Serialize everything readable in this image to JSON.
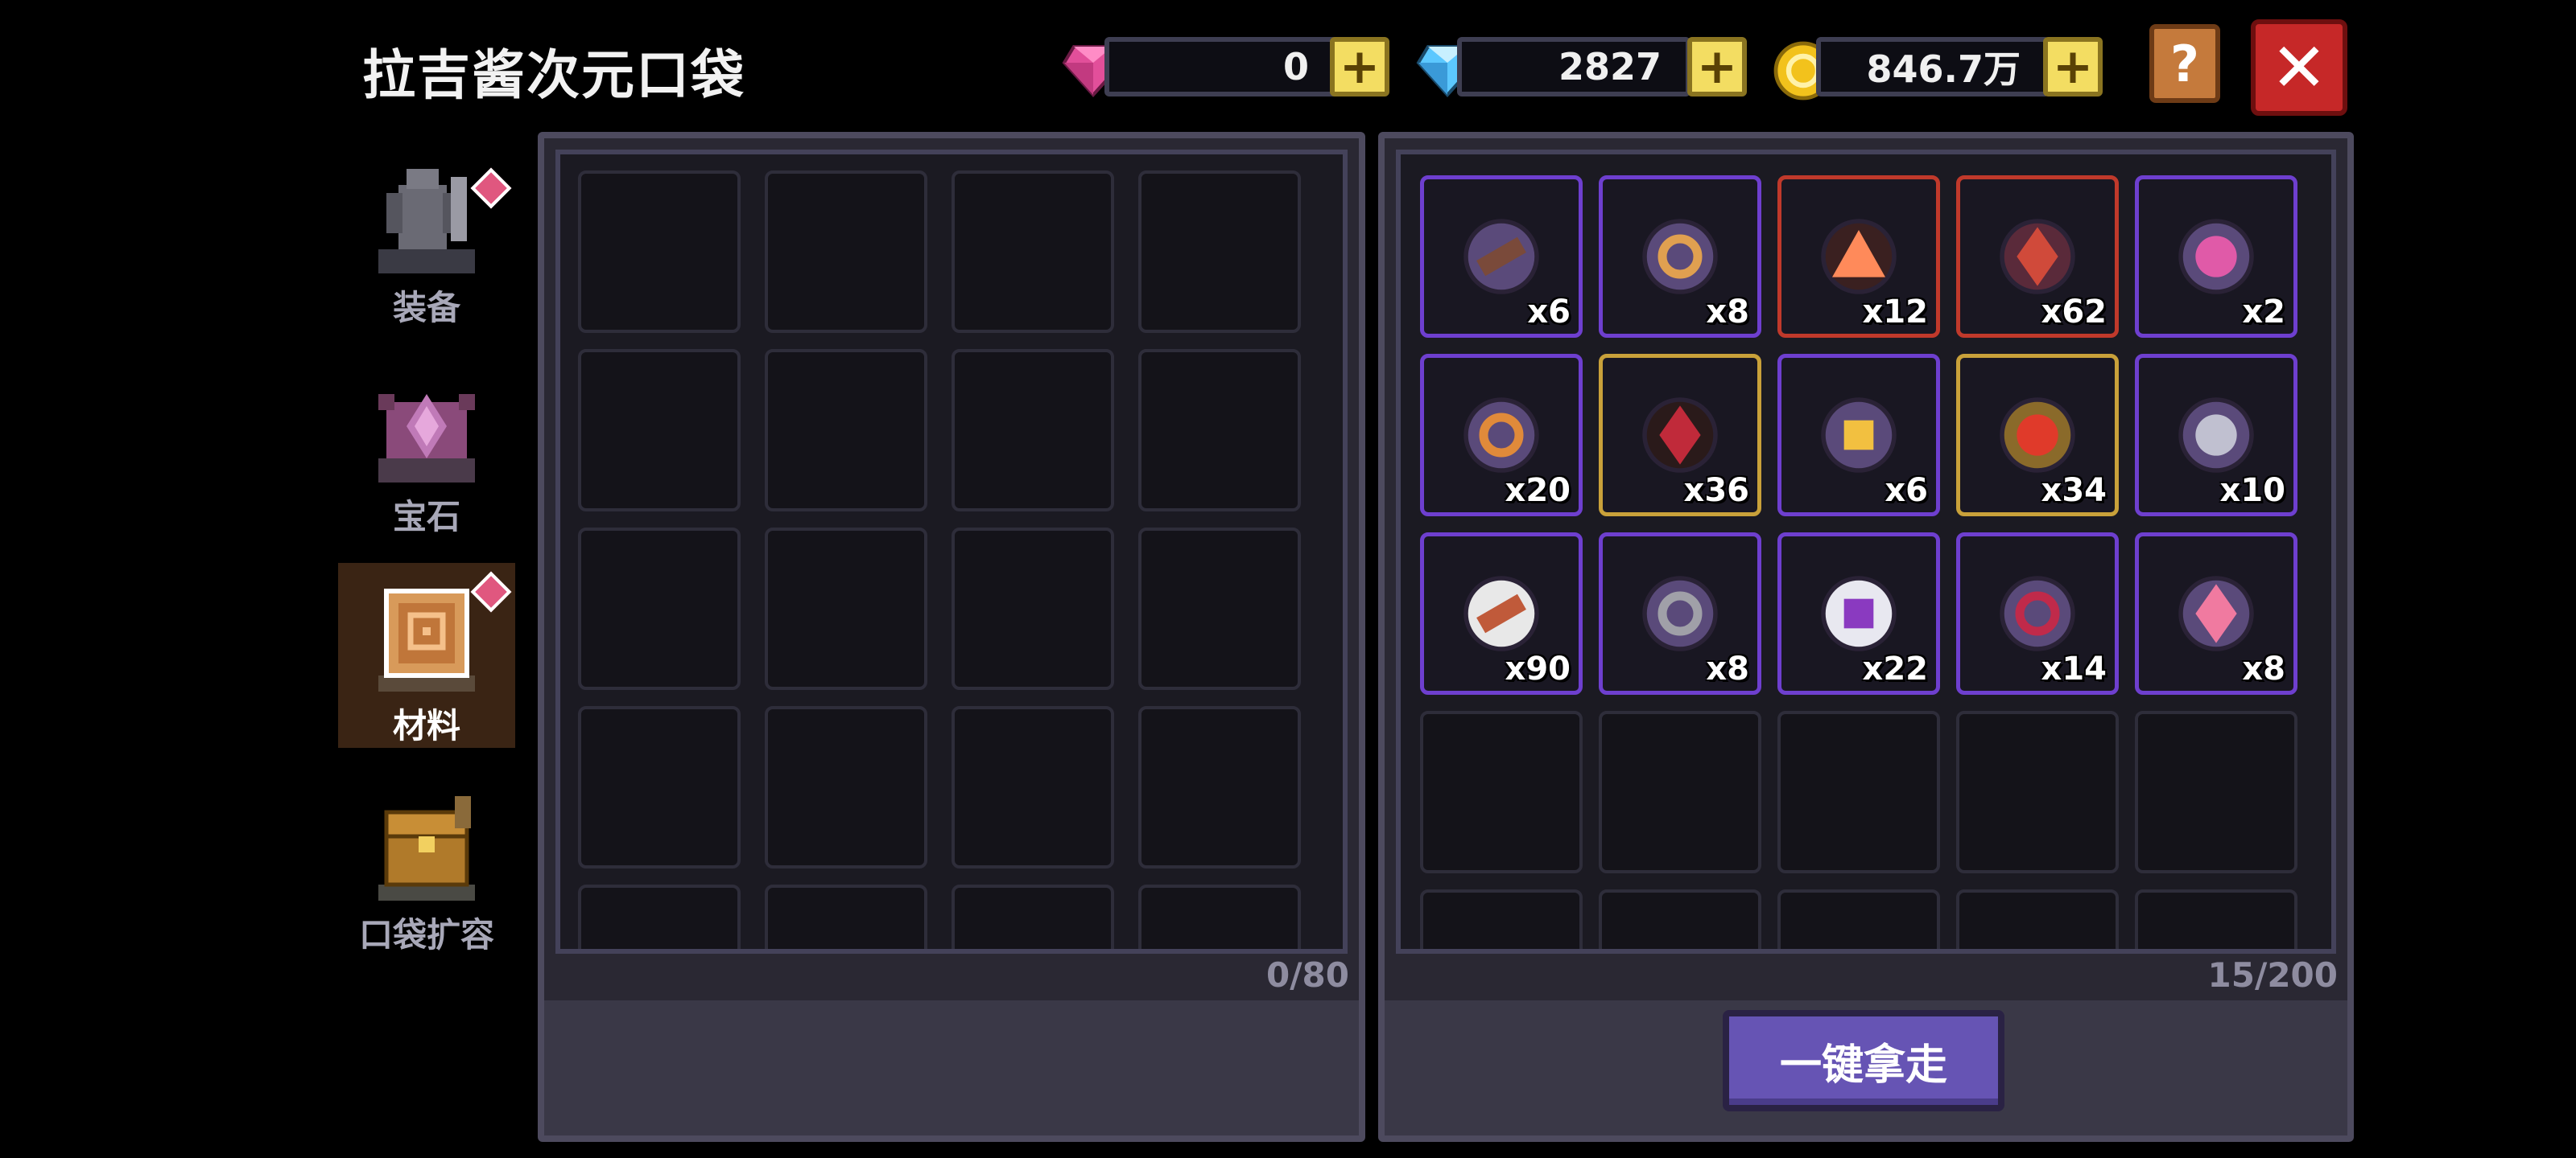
{
  "header": {
    "title": "拉吉酱次元口袋",
    "currencies": [
      {
        "name": "pink-gem",
        "icon": "pink-gem-icon",
        "value": "0",
        "color": "#e24f9a"
      },
      {
        "name": "blue-gem",
        "icon": "blue-diamond-icon",
        "value": "2827",
        "color": "#5cc8ff"
      },
      {
        "name": "gold-coin",
        "icon": "gold-coin-icon",
        "value": "846.7万",
        "color": "#f2c21c"
      }
    ],
    "help_label": "?",
    "close_label": "✕"
  },
  "sidebar": {
    "items": [
      {
        "label": "装备",
        "icon": "armor-icon",
        "badge": true,
        "active": false
      },
      {
        "label": "宝石",
        "icon": "gem-altar-icon",
        "badge": false,
        "active": false
      },
      {
        "label": "材料",
        "icon": "material-book-icon",
        "badge": true,
        "active": true
      },
      {
        "label": "口袋扩容",
        "icon": "treasure-chest-icon",
        "badge": false,
        "active": false
      }
    ]
  },
  "left_panel": {
    "capacity": "0/80"
  },
  "right_panel": {
    "capacity": "15/200",
    "take_all_label": "一键拿走",
    "items": [
      {
        "icon": "rifle-material-icon",
        "qty": "x6",
        "rarity": "purple"
      },
      {
        "icon": "armor-part-material-icon",
        "qty": "x8",
        "rarity": "purple"
      },
      {
        "icon": "fire-crystal-icon",
        "qty": "x12",
        "rarity": "red"
      },
      {
        "icon": "dragon-scale-icon",
        "qty": "x62",
        "rarity": "red"
      },
      {
        "icon": "pink-slime-icon",
        "qty": "x2",
        "rarity": "purple"
      },
      {
        "icon": "bronze-ring-icon",
        "qty": "x20",
        "rarity": "purple"
      },
      {
        "icon": "red-ore-icon",
        "qty": "x36",
        "rarity": "gold"
      },
      {
        "icon": "lantern-core-icon",
        "qty": "x6",
        "rarity": "purple"
      },
      {
        "icon": "flame-emblem-icon",
        "qty": "x34",
        "rarity": "gold"
      },
      {
        "icon": "helmet-shard-icon",
        "qty": "x10",
        "rarity": "purple"
      },
      {
        "icon": "copper-plate-icon",
        "qty": "x90",
        "rarity": "purple"
      },
      {
        "icon": "gear-wheel-icon",
        "qty": "x8",
        "rarity": "purple"
      },
      {
        "icon": "purple-rune-icon",
        "qty": "x22",
        "rarity": "purple"
      },
      {
        "icon": "red-whip-icon",
        "qty": "x14",
        "rarity": "purple"
      },
      {
        "icon": "pink-crystal-icon",
        "qty": "x8",
        "rarity": "purple"
      }
    ]
  }
}
